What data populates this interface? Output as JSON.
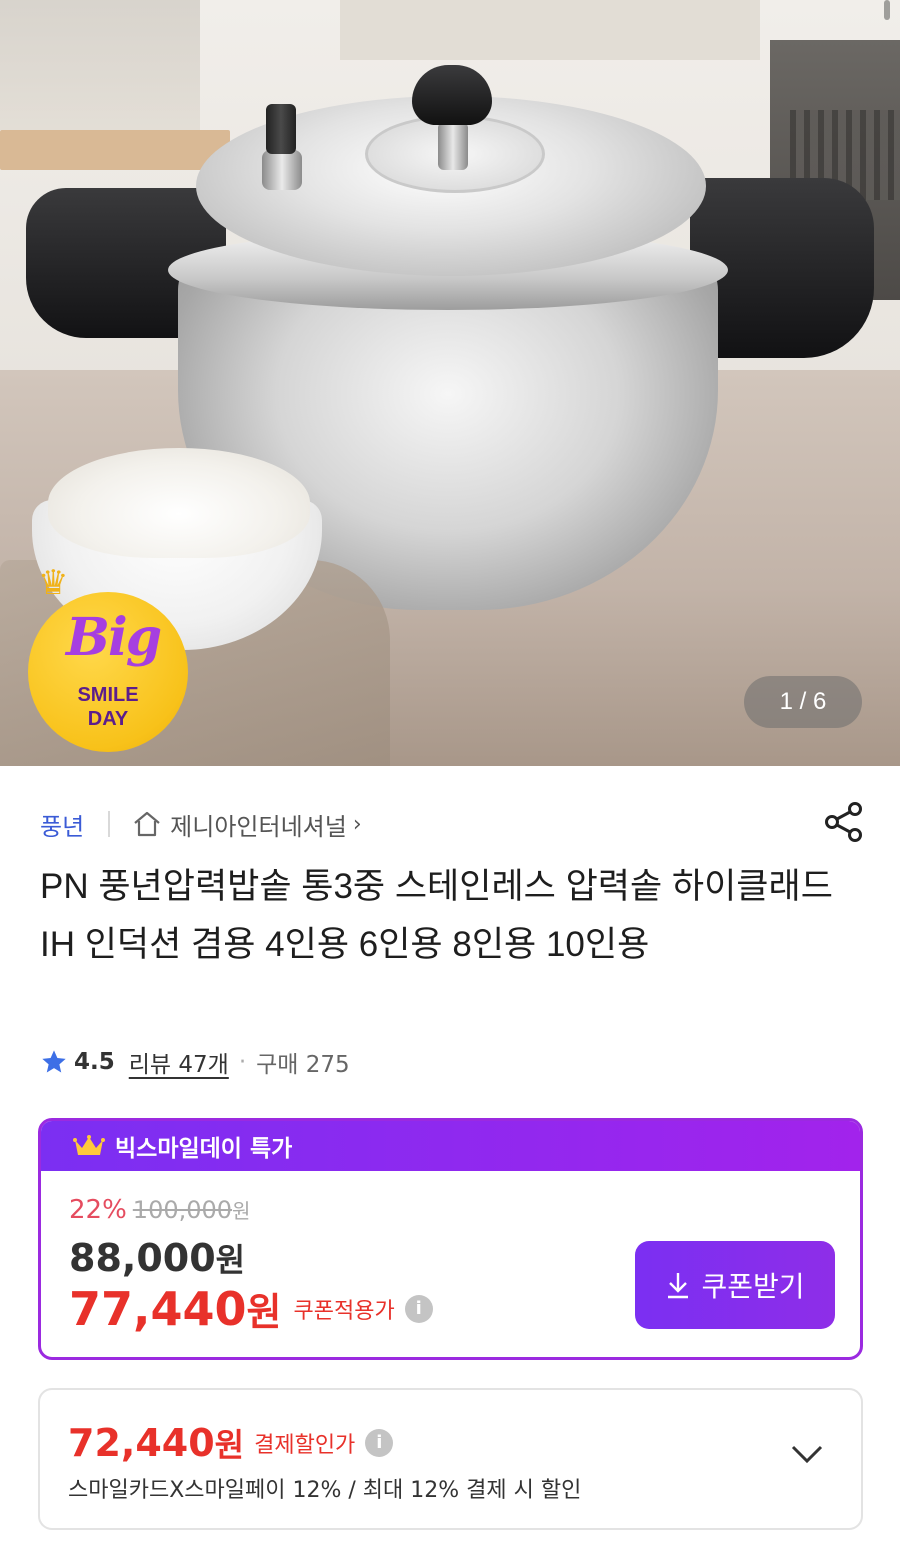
{
  "hero": {
    "badge_big": "Big",
    "badge_line1": "SMILE",
    "badge_line2": "DAY",
    "pager": "1 / 6"
  },
  "seller": {
    "brand": "풍년",
    "store": "제니아인터네셔널",
    "store_chevron": "›"
  },
  "product": {
    "title": "PN 풍년압력밥솥 통3중 스테인레스 압력솥 하이클래드 IH 인덕션 겸용 4인용 6인용 8인용 10인용"
  },
  "rating": {
    "score": "4.5",
    "reviews": "리뷰 47개",
    "separator": "·",
    "purchases": "구매 275"
  },
  "deal": {
    "header": "빅스마일데이 특가",
    "discount_pct": "22%",
    "original_price": "100,000",
    "original_unit": "원",
    "price": "88,000",
    "price_unit": "원",
    "coupon_price": "77,440",
    "coupon_unit": "원",
    "coupon_label": "쿠폰적용가",
    "info_glyph": "i",
    "coupon_button": "쿠폰받기",
    "accent": "#8a2be2",
    "sale_red": "#e8312a"
  },
  "payment": {
    "price": "72,440",
    "unit": "원",
    "label": "결제할인가",
    "info_glyph": "i",
    "description": "스마일카드X스마일페이 12% / 최대 12% 결제 시 할인"
  },
  "icons": {
    "store": "home-icon",
    "share": "share-icon",
    "star": "star-icon",
    "crown": "crown-icon",
    "download": "download-icon",
    "expand": "chevron-down-icon"
  }
}
